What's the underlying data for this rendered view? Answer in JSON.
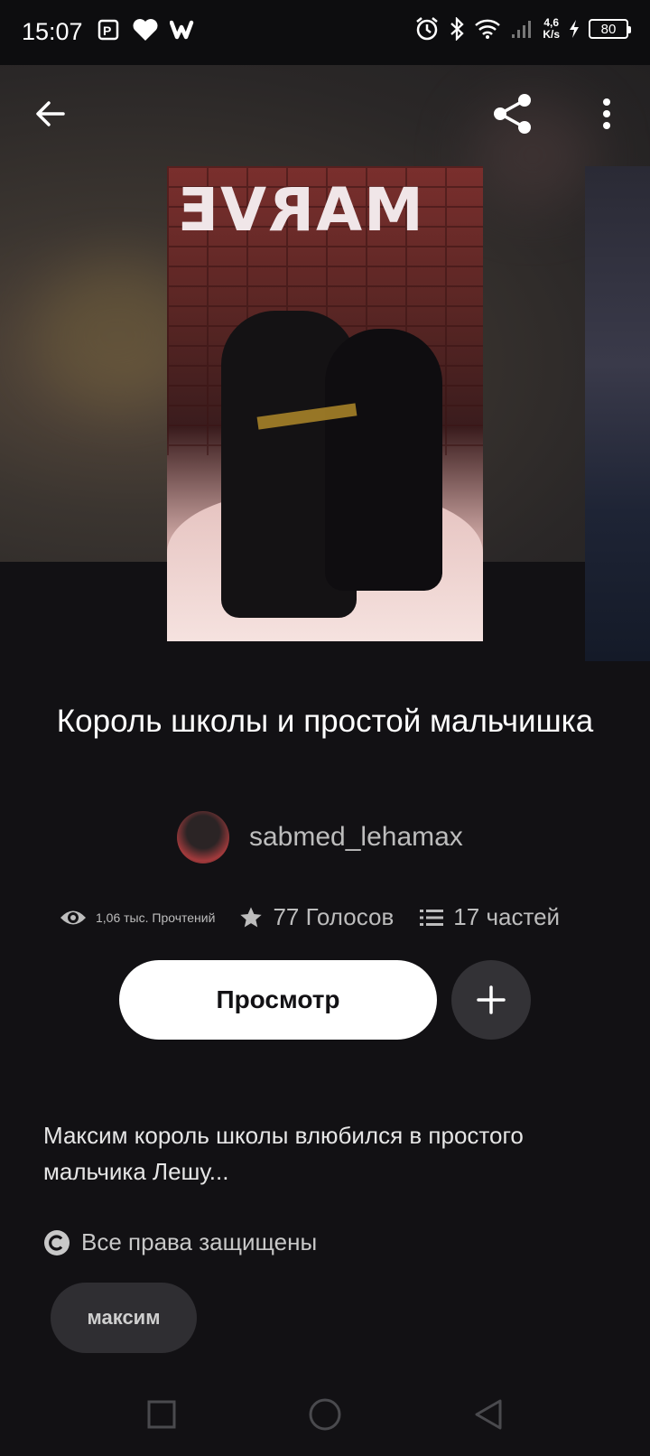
{
  "status_bar": {
    "time": "15:07",
    "net_speed_value": "4,6",
    "net_speed_unit": "K/s",
    "battery": "80"
  },
  "hero": {
    "cover_sign_text": "MARVE"
  },
  "story": {
    "title": "Король школы и простой мальчишка",
    "author": "sabmed_lehamax",
    "reads": "1,06 тыс. Прочтений",
    "votes": "77 Голосов",
    "parts": "17 частей",
    "view_button": "Просмотр",
    "description": "Максим король школы влюбился в простого мальчика Лешу...",
    "rights": "Все права защищены",
    "tags": [
      "максим"
    ]
  },
  "icons": {
    "back": "back-arrow-icon",
    "share": "share-icon",
    "more": "more-vertical-icon",
    "eye": "eye-icon",
    "star": "star-icon",
    "list": "list-icon",
    "plus": "plus-icon",
    "copyright": "copyright-icon"
  },
  "colors": {
    "background": "#121114",
    "button_bg": "#ffffff",
    "secondary_text": "#bdbdbd"
  }
}
